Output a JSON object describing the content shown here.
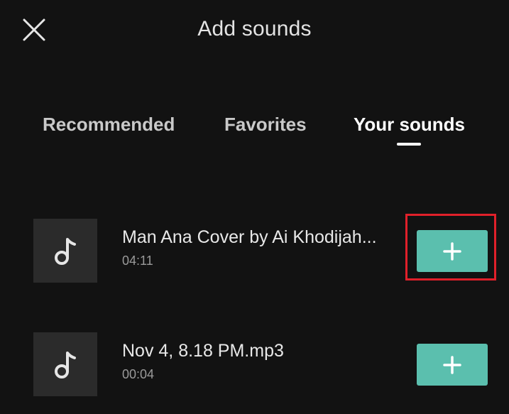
{
  "header": {
    "title": "Add sounds",
    "close_icon": "close-icon"
  },
  "tabs": [
    {
      "label": "Recommended",
      "active": false
    },
    {
      "label": "Favorites",
      "active": false
    },
    {
      "label": "Your sounds",
      "active": true
    }
  ],
  "sounds": [
    {
      "name": "Man Ana Cover by Ai Khodijah...",
      "duration": "04:11",
      "icon": "music-note-icon",
      "action_icon": "plus-icon",
      "highlighted": true
    },
    {
      "name": "Nov 4, 8.18 PM.mp3",
      "duration": "00:04",
      "icon": "music-note-icon",
      "action_icon": "plus-icon",
      "highlighted": false
    }
  ],
  "colors": {
    "background": "#121212",
    "thumbnail": "#2b2b2b",
    "add_button": "#5bbfae",
    "highlight": "#e0202a",
    "active_tab": "#ffffff",
    "inactive_tab": "#c9c9c9"
  }
}
